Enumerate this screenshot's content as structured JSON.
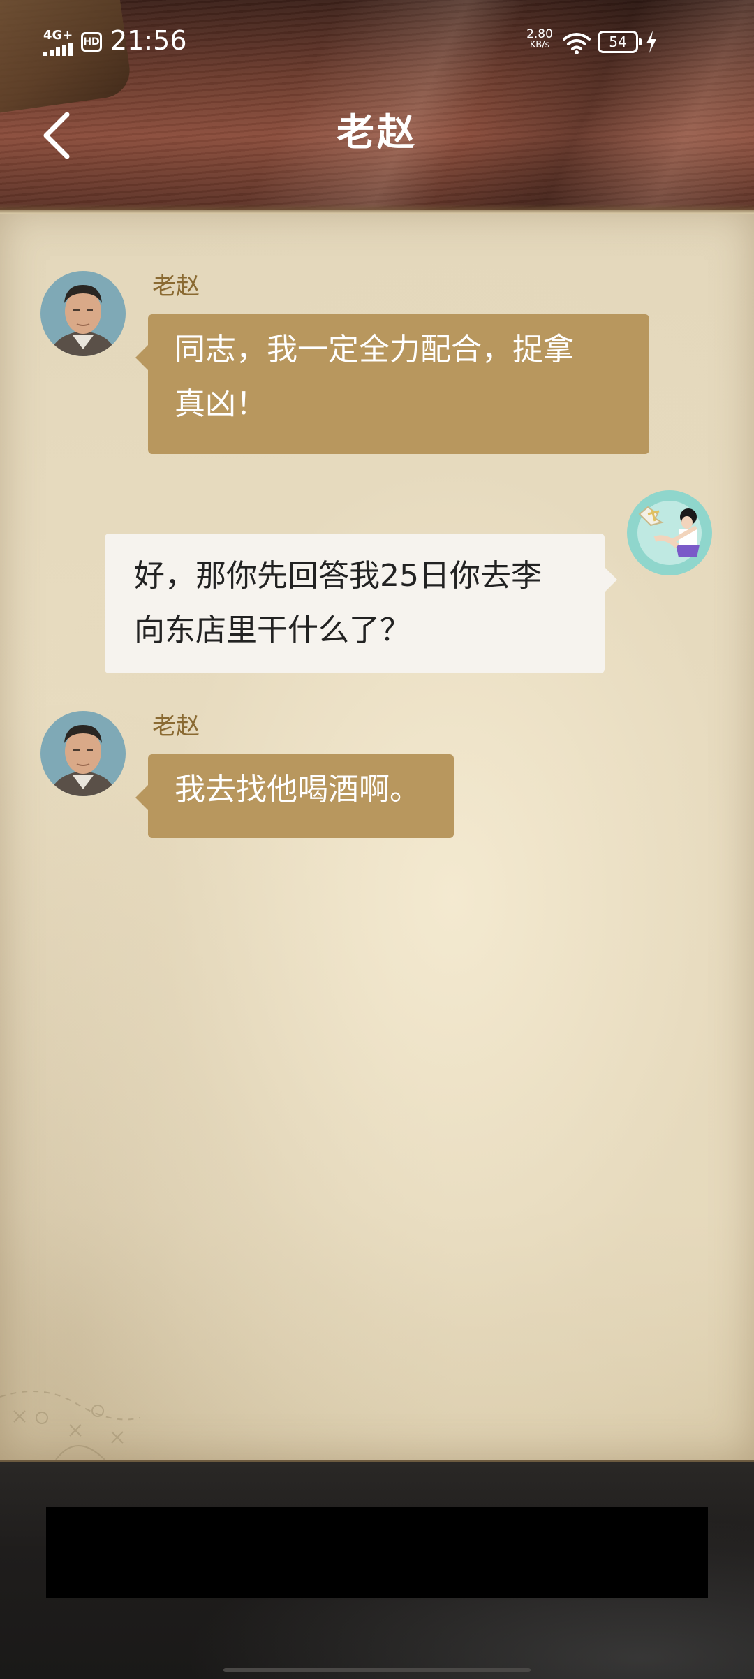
{
  "status_bar": {
    "network": "4G+",
    "hd": "HD",
    "time": "21:56",
    "net_speed_value": "2.80",
    "net_speed_unit": "KB/s",
    "battery": "54",
    "icons": [
      "signal-icon",
      "hd-icon",
      "wifi-icon",
      "battery-icon",
      "charging-icon"
    ]
  },
  "header": {
    "title": "老赵",
    "back_icon": "chevron-left-icon"
  },
  "messages": [
    {
      "direction": "incoming",
      "sender": "老赵",
      "lines": [
        "同志，我一定全力配合，捉拿",
        "真凶！"
      ]
    },
    {
      "direction": "outgoing",
      "lines": [
        "好，那你先回答我25日你去李",
        "向东店里干什么了？"
      ]
    },
    {
      "direction": "incoming",
      "sender": "老赵",
      "lines": [
        "我去找他喝酒啊。"
      ]
    }
  ],
  "colors": {
    "incoming_bubble": "#b8975e",
    "outgoing_bubble": "#f6f3ee",
    "sender_name": "#8a6a32",
    "paper": "#e6d9bb",
    "header_wood": "#6a3a2c"
  }
}
